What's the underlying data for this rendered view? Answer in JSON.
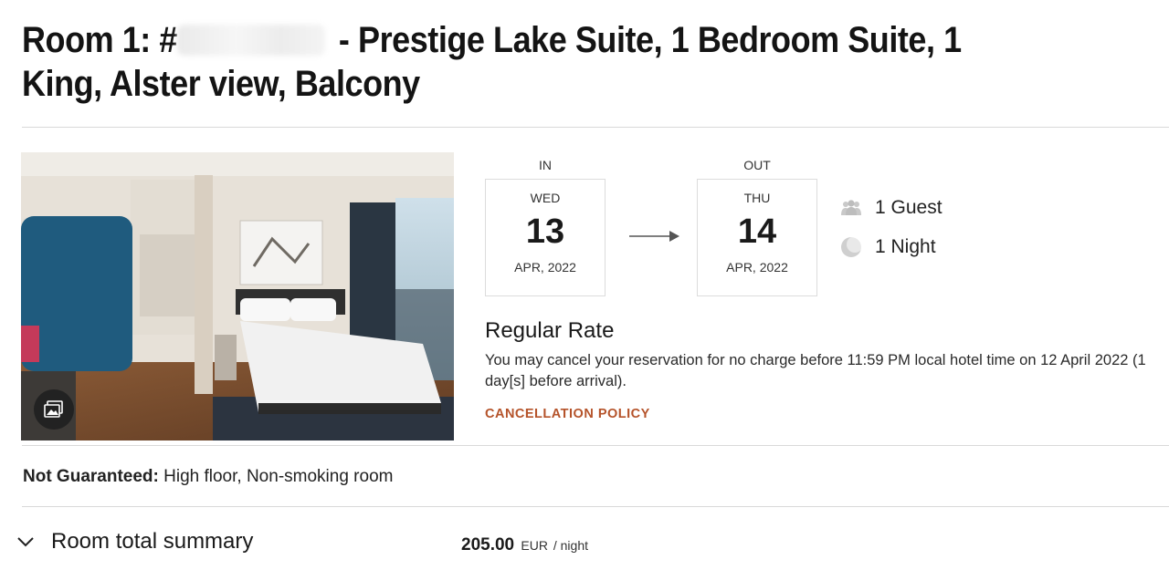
{
  "room": {
    "title_prefix": "Room 1: #",
    "title_suffix": " - Prestige Lake Suite, 1 Bedroom Suite, 1 King, Alster view, Balcony"
  },
  "stay": {
    "in_label": "IN",
    "out_label": "OUT",
    "checkin": {
      "dow": "WED",
      "day": "13",
      "month_year": "APR, 2022"
    },
    "checkout": {
      "dow": "THU",
      "day": "14",
      "month_year": "APR, 2022"
    },
    "guests": "1 Guest",
    "nights": "1 Night",
    "guests_icon": "guests-icon",
    "nights_icon": "moon-icon"
  },
  "rate": {
    "title": "Regular Rate",
    "description": "You may cancel your reservation for no charge before 11:59 PM local hotel time on 12 April 2022 (1 day[s] before arrival).",
    "cancellation_link": "CANCELLATION POLICY"
  },
  "preferences": {
    "label": "Not Guaranteed:",
    "value": " High floor, Non-smoking room"
  },
  "summary": {
    "label": "Room total summary",
    "price": "205.00",
    "currency": "EUR",
    "per": " / night"
  },
  "colors": {
    "accent": "#b5532a",
    "divider": "#d9d9d9"
  }
}
